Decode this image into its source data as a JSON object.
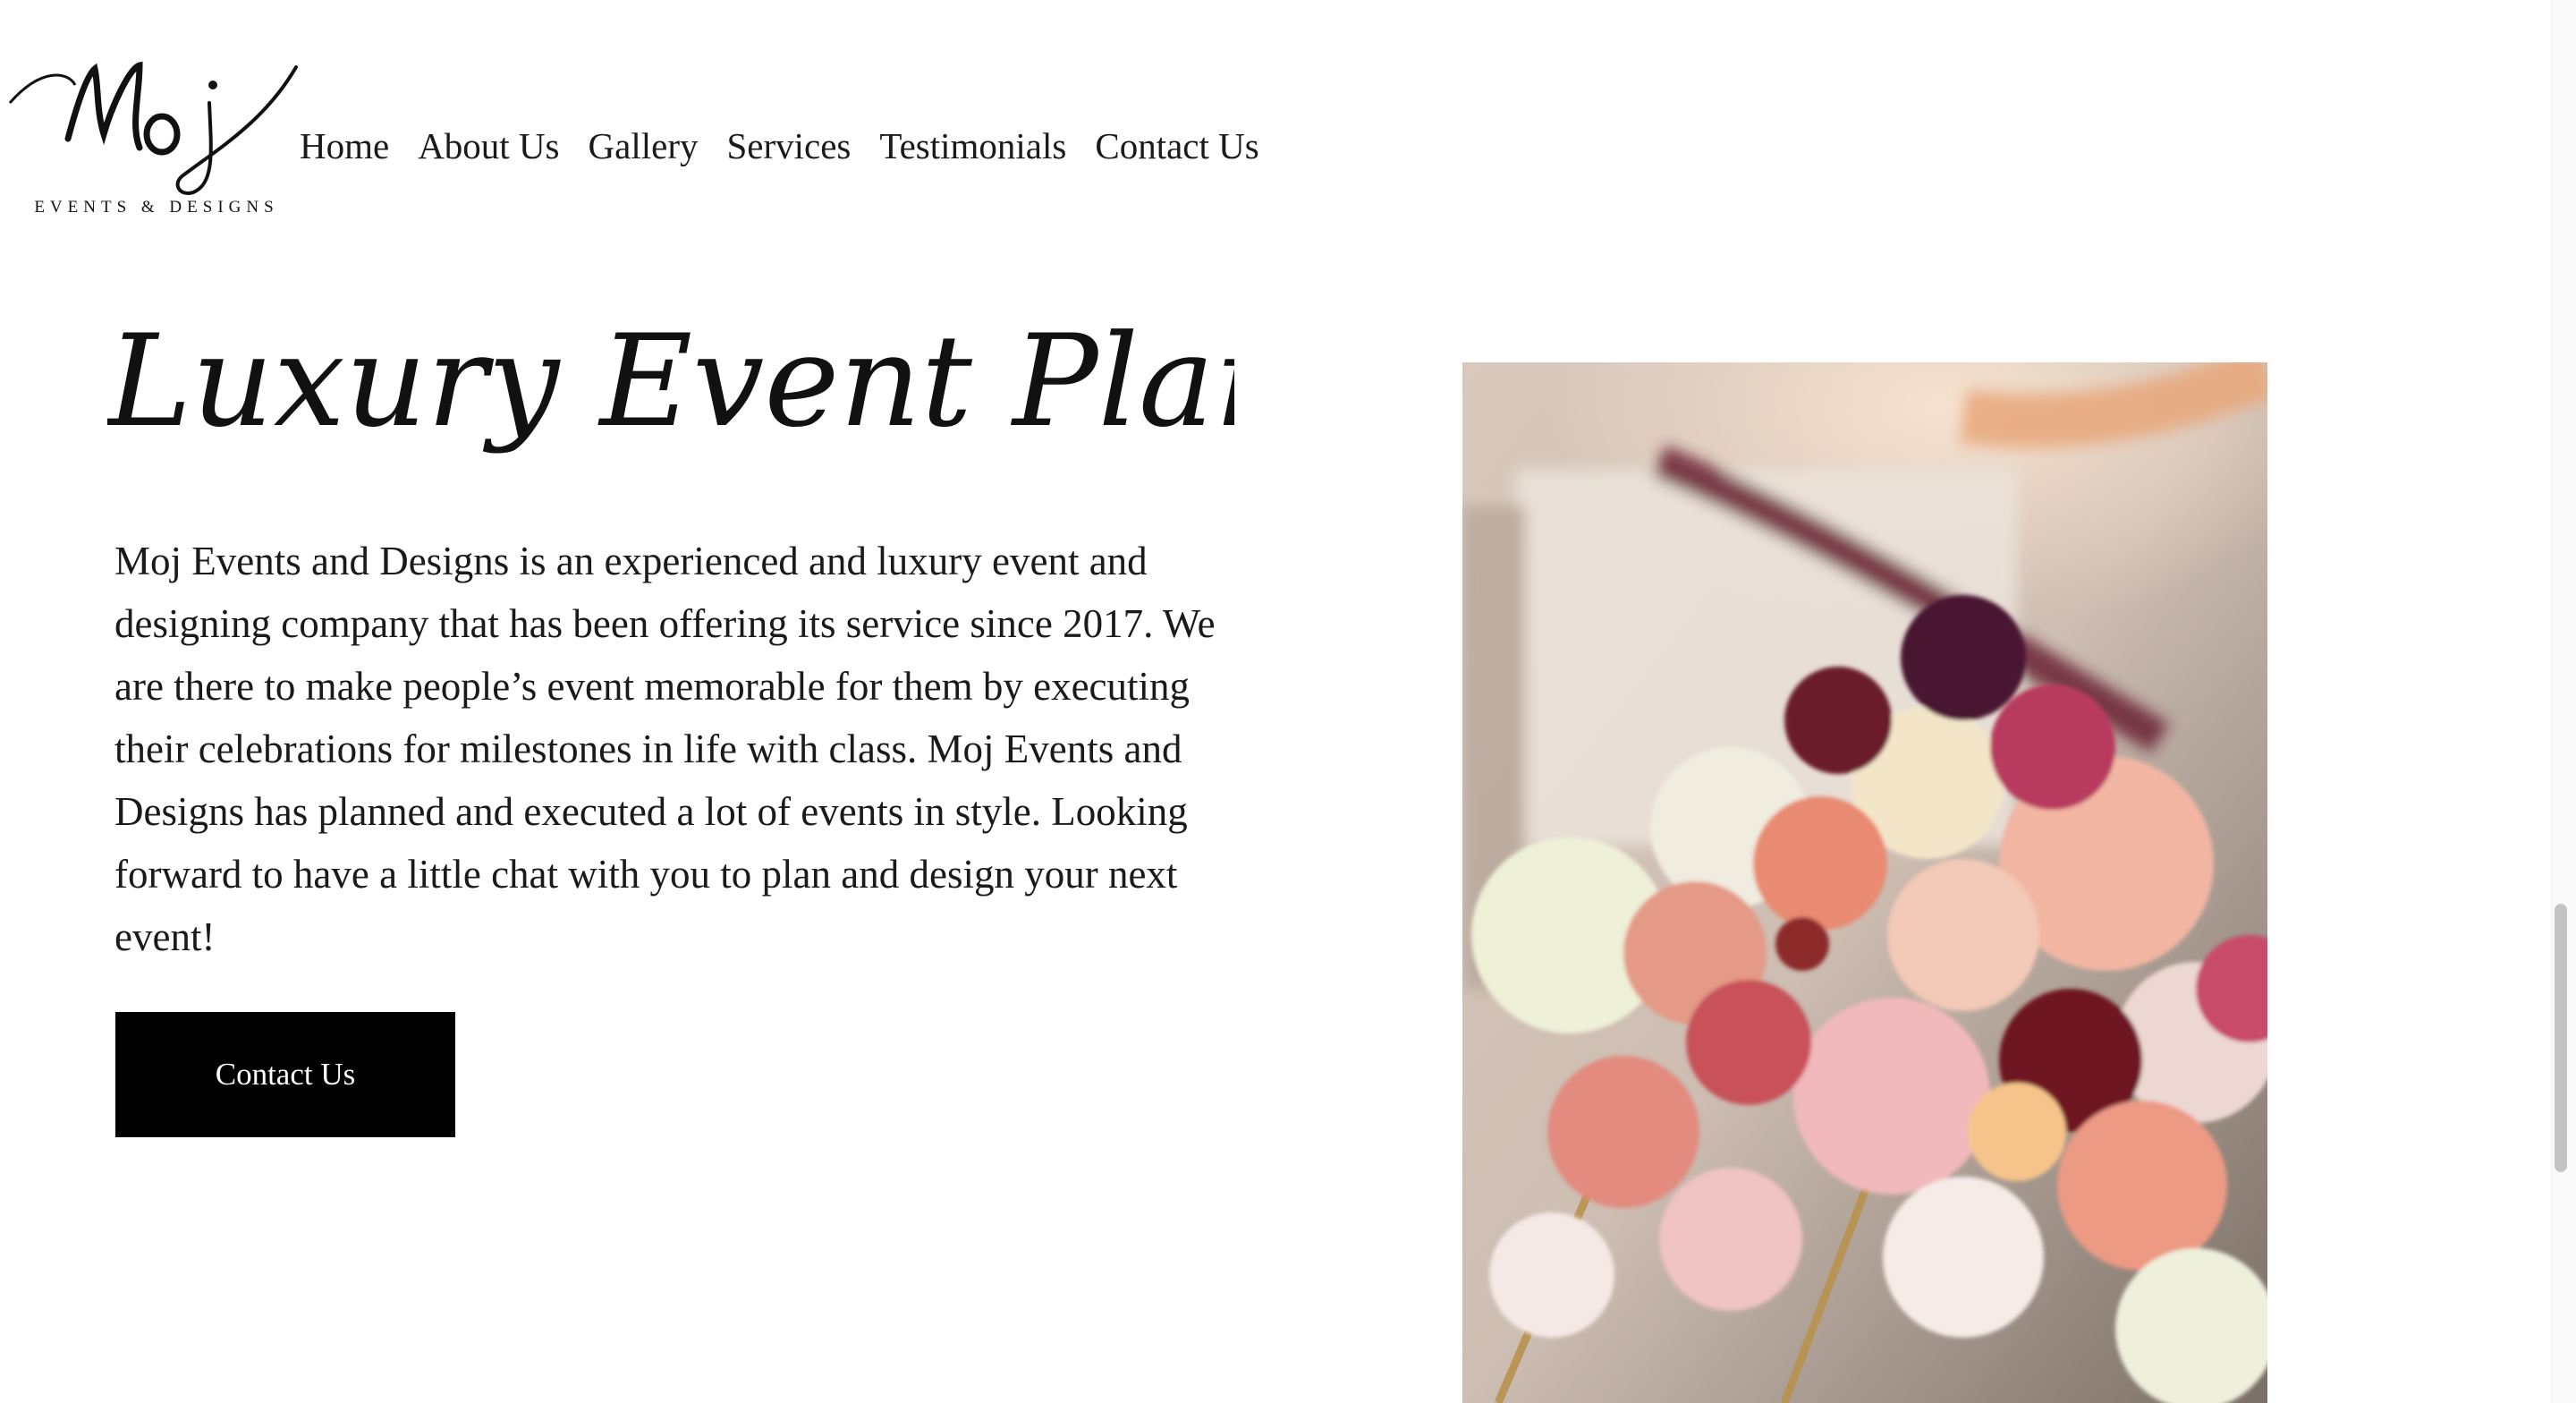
{
  "brand": {
    "name": "Moj",
    "tagline": "EVENTS & DESIGNS"
  },
  "nav": {
    "items": [
      {
        "label": "Home"
      },
      {
        "label": "About Us"
      },
      {
        "label": "Gallery"
      },
      {
        "label": "Services"
      },
      {
        "label": "Testimonials"
      },
      {
        "label": "Contact Us"
      }
    ]
  },
  "hero": {
    "title": "Luxury Event Planning",
    "description": "Moj Events and Designs is an experienced and luxury event and designing company that has been offering its service since 2017. We are there to make people’s event memorable for them by executing their celebrations for milestones in life with class. Moj Events and Designs has planned and executed a lot of events in style. Looking forward to have a little chat with you to plan and design your next event!",
    "cta_label": "Contact Us"
  },
  "colors": {
    "button_bg": "#000000",
    "button_text": "#ffffff",
    "text": "#1a1a1a"
  }
}
